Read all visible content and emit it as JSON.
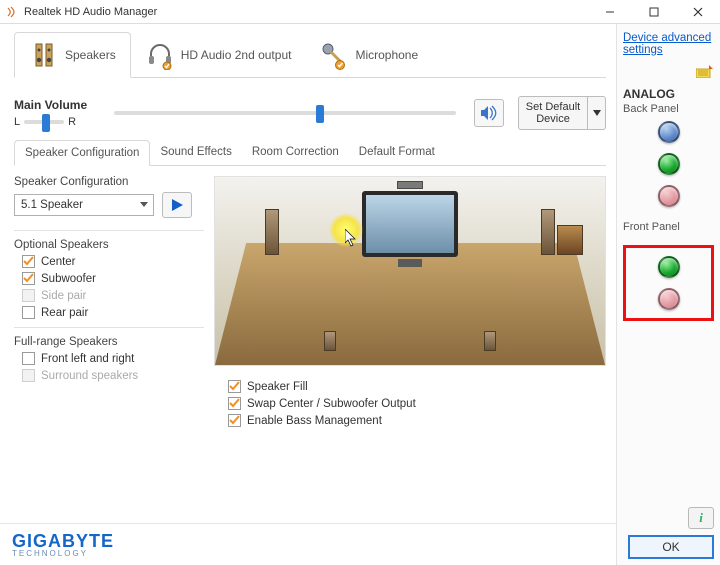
{
  "window": {
    "title": "Realtek HD Audio Manager"
  },
  "topTabs": {
    "speakers": "Speakers",
    "hd2nd": "HD Audio 2nd output",
    "mic": "Microphone"
  },
  "volume": {
    "label": "Main Volume",
    "L": "L",
    "R": "R",
    "balancePct": 45,
    "mainPct": 59,
    "setDefault": "Set Default Device"
  },
  "subTabs": {
    "config": "Speaker Configuration",
    "fx": "Sound Effects",
    "room": "Room Correction",
    "fmt": "Default Format"
  },
  "config": {
    "label": "Speaker Configuration",
    "selected": "5.1 Speaker",
    "optionalLabel": "Optional Speakers",
    "optCenter": "Center",
    "optSubwoofer": "Subwoofer",
    "optSidePair": "Side pair",
    "optRearPair": "Rear pair",
    "fullRangeLabel": "Full-range Speakers",
    "frFrontLR": "Front left and right",
    "frSurround": "Surround speakers",
    "speakerFill": "Speaker Fill",
    "swapCenter": "Swap Center / Subwoofer Output",
    "enableBass": "Enable Bass Management"
  },
  "side": {
    "advLink": "Device advanced settings",
    "analog": "ANALOG",
    "backPanel": "Back Panel",
    "frontPanel": "Front Panel"
  },
  "footer": {
    "brandTop": "GIGABYTE",
    "brandSub": "TECHNOLOGY",
    "ok": "OK",
    "info": "i"
  }
}
